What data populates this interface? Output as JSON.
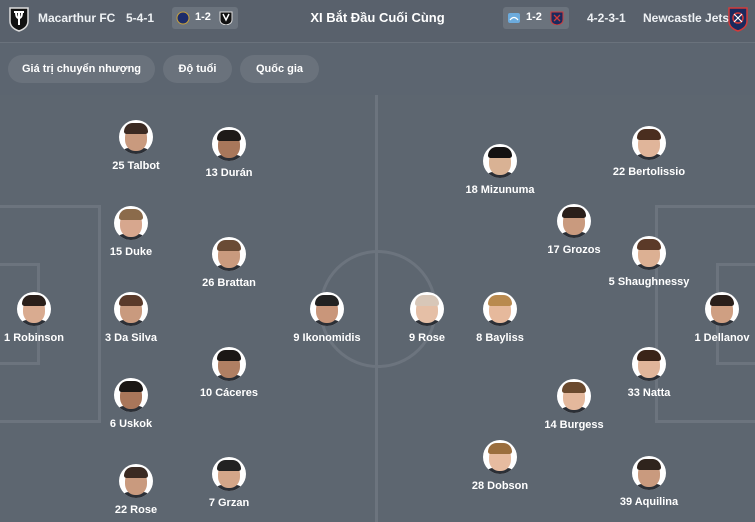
{
  "header": {
    "home_team": "Macarthur FC",
    "home_formation": "5-4-1",
    "home_score": "1-2",
    "title": "XI Bắt Đầu Cuối Cùng",
    "away_score": "1-2",
    "away_formation": "4-2-3-1",
    "away_team": "Newcastle Jets"
  },
  "tabs": [
    "Giá trị chuyển nhượng",
    "Độ tuổi",
    "Quốc gia"
  ],
  "home_players": [
    {
      "label": "25 Talbot"
    },
    {
      "label": "13 Durán"
    },
    {
      "label": "15 Duke"
    },
    {
      "label": "26 Brattan"
    },
    {
      "label": "1 Robinson"
    },
    {
      "label": "3 Da Silva"
    },
    {
      "label": "9 Ikonomidis"
    },
    {
      "label": "10 Cáceres"
    },
    {
      "label": "6 Uskok"
    },
    {
      "label": "22 Rose"
    },
    {
      "label": "7 Grzan"
    }
  ],
  "away_players": [
    {
      "label": "18 Mizunuma"
    },
    {
      "label": "22 Bertolissio"
    },
    {
      "label": "17 Grozos"
    },
    {
      "label": "5 Shaughnessy"
    },
    {
      "label": "9 Rose"
    },
    {
      "label": "8 Bayliss"
    },
    {
      "label": "1 Dellanov"
    },
    {
      "label": "33 Natta"
    },
    {
      "label": "14 Burgess"
    },
    {
      "label": "28 Dobson"
    },
    {
      "label": "39 Aquilina"
    }
  ],
  "colors": {
    "background": "#5c6570",
    "pitch_lines": "#6c747e",
    "tab_bg": "#6a727c"
  },
  "icons": {
    "home_crest": "macarthur-crest-icon",
    "away_crest": "newcastle-crest-icon"
  }
}
